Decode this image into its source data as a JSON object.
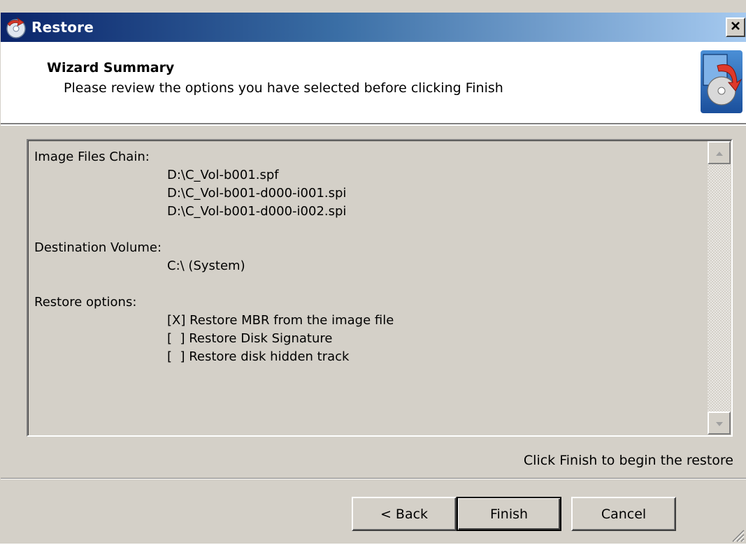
{
  "window": {
    "title": "Restore",
    "close_label": "×"
  },
  "header": {
    "title": "Wizard Summary",
    "subtitle": "Please review the options you have selected before clicking Finish"
  },
  "summary": {
    "sections": [
      {
        "label": "Image Files Chain:",
        "items": [
          "D:\\C_Vol-b001.spf",
          "D:\\C_Vol-b001-d000-i001.spi",
          "D:\\C_Vol-b001-d000-i002.spi"
        ]
      },
      {
        "label": "Destination Volume:",
        "items": [
          "C:\\ (System)"
        ]
      },
      {
        "label": "Restore options:",
        "items": [
          "[X] Restore MBR from the image file",
          "[  ] Restore Disk Signature",
          "[  ] Restore disk hidden track"
        ]
      }
    ]
  },
  "footer": {
    "hint": "Click Finish to begin the restore"
  },
  "buttons": {
    "back": "< Back",
    "finish": "Finish",
    "cancel": "Cancel"
  },
  "icons": {
    "title": "restore-app-icon",
    "header": "disc-restore-icon",
    "close": "close-icon",
    "scroll_up": "scroll-up-arrow-icon",
    "scroll_down": "scroll-down-arrow-icon"
  }
}
